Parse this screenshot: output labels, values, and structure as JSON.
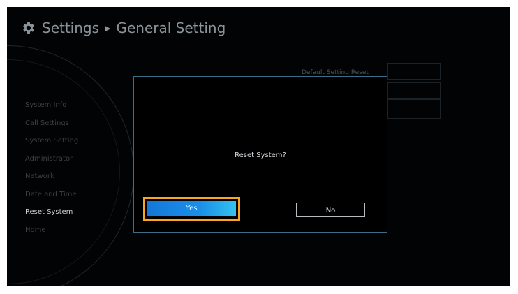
{
  "header": {
    "title": "Settings",
    "separator_icon": "triangle-right",
    "subtitle": "General Setting",
    "icon": "gear-icon"
  },
  "sidebar": {
    "items": [
      {
        "label": "System Info",
        "active": false
      },
      {
        "label": "Call Settings",
        "active": false
      },
      {
        "label": "System Setting",
        "active": false
      },
      {
        "label": "Administrator",
        "active": false
      },
      {
        "label": "Network",
        "active": false
      },
      {
        "label": "Date and Time",
        "active": false
      },
      {
        "label": "Reset System",
        "active": true
      },
      {
        "label": "Home",
        "active": false
      }
    ]
  },
  "background_panel": {
    "title": "Default Setting Reset"
  },
  "dialog": {
    "message": "Reset System?",
    "yes_label": "Yes",
    "no_label": "No",
    "focused_button": "yes"
  },
  "colors": {
    "background": "#020304",
    "dialog_border": "#3c6c86",
    "focus_ring": "#f7a81e",
    "yes_button": "#1a8fe8",
    "text_active": "#c9cfd3",
    "text_dim": "#3a4147"
  }
}
